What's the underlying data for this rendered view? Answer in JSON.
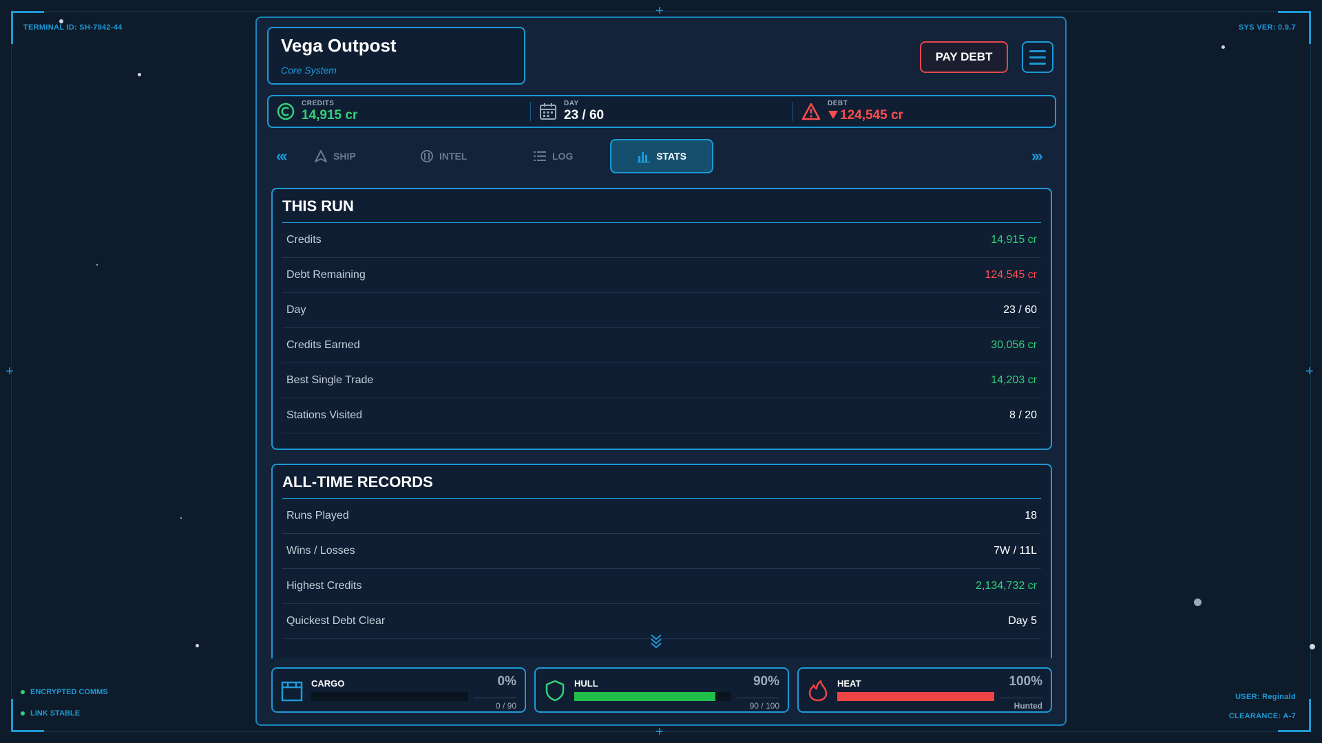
{
  "hud": {
    "terminal_id": "TERMINAL ID: SH-7942-44",
    "sys_ver": "SYS VER: 0.9.7",
    "status_comms": "ENCRYPTED COMMS",
    "status_link": "LINK STABLE",
    "user": "USER: Reginald",
    "clearance": "CLEARANCE: A-7"
  },
  "station": {
    "name": "Vega Outpost",
    "system": "Core System"
  },
  "header": {
    "pay_debt_label": "PAY DEBT",
    "menu_icon": "hamburger-menu-icon"
  },
  "stats_bar": {
    "credits": {
      "label": "CREDITS",
      "value": "14,915 cr",
      "icon": "credits-coin-icon",
      "color": "#33d17a"
    },
    "day": {
      "label": "DAY",
      "value": "23 / 60",
      "icon": "calendar-icon"
    },
    "debt": {
      "label": "DEBT",
      "value": "124,545 cr",
      "icon": "warning-triangle-icon",
      "trend_icon": "down-triangle-icon",
      "color": "#ff4d4f"
    }
  },
  "tabs": [
    {
      "label": "SHIP",
      "icon": "ship-icon",
      "active": false
    },
    {
      "label": "INTEL",
      "icon": "intel-icon",
      "active": false
    },
    {
      "label": "LOG",
      "icon": "list-icon",
      "active": false
    },
    {
      "label": "STATS",
      "icon": "bar-chart-icon",
      "active": true
    }
  ],
  "this_run": {
    "title": "THIS RUN",
    "rows": [
      {
        "label": "Credits",
        "value": "14,915 cr",
        "tone": "green"
      },
      {
        "label": "Debt Remaining",
        "value": "124,545 cr",
        "tone": "red"
      },
      {
        "label": "Day",
        "value": "23 / 60",
        "tone": "white"
      },
      {
        "label": "Credits Earned",
        "value": "30,056 cr",
        "tone": "green"
      },
      {
        "label": "Best Single Trade",
        "value": "14,203 cr",
        "tone": "green"
      },
      {
        "label": "Stations Visited",
        "value": "8 / 20",
        "tone": "white"
      }
    ]
  },
  "all_time": {
    "title": "ALL-TIME RECORDS",
    "rows": [
      {
        "label": "Runs Played",
        "value": "18",
        "tone": "white"
      },
      {
        "label": "Wins / Losses",
        "value": "7W / 11L",
        "tone": "white"
      },
      {
        "label": "Highest Credits",
        "value": "2,134,732 cr",
        "tone": "green"
      },
      {
        "label": "Quickest Debt Clear",
        "value": "Day 5",
        "tone": "white"
      }
    ]
  },
  "gauges": {
    "cargo": {
      "label": "CARGO",
      "percent_text": "0%",
      "sub": "0 / 90",
      "fill": 0.0,
      "color": "#33d17a",
      "icon": "cargo-crate-icon"
    },
    "hull": {
      "label": "HULL",
      "percent_text": "90%",
      "sub": "90 / 100",
      "fill": 0.9,
      "color": "#1fbf4a",
      "icon": "shield-icon"
    },
    "heat": {
      "label": "HEAT",
      "percent_text": "100%",
      "sub": "Hunted",
      "fill": 1.0,
      "color": "#ef4444",
      "icon": "flame-icon"
    }
  }
}
